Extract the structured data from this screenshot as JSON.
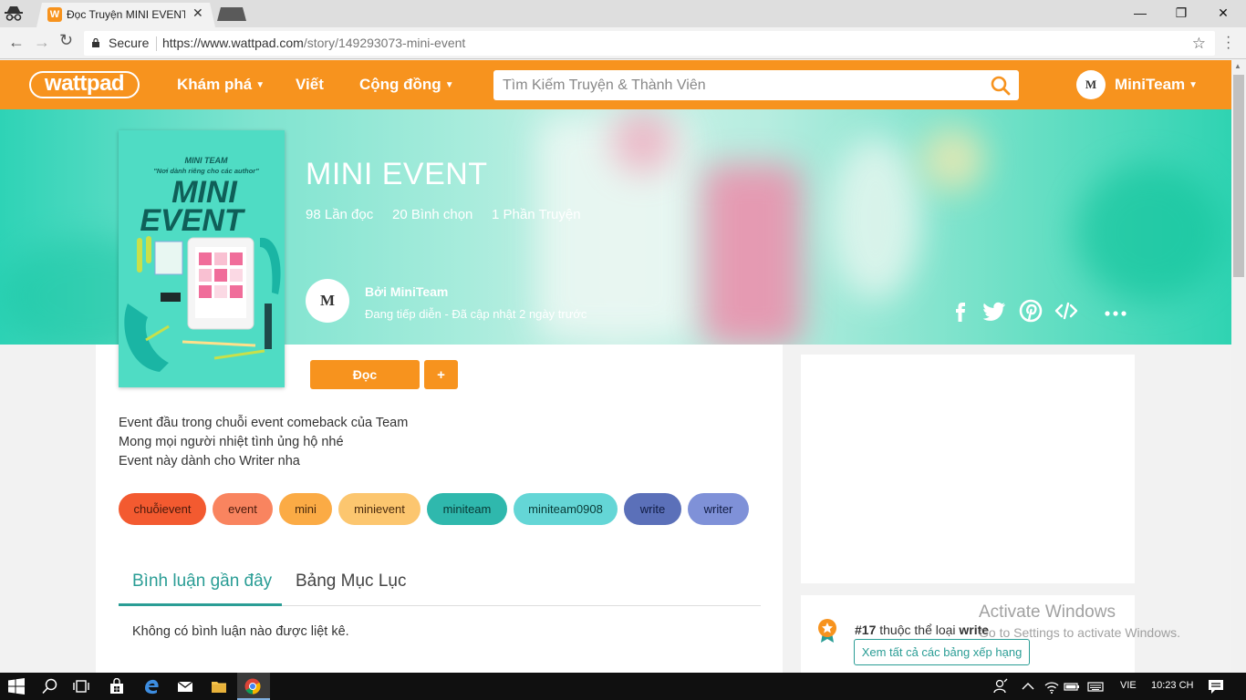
{
  "browser": {
    "tab_title": "Đọc Truyện MINI EVENT -",
    "tab_favicon": "W",
    "secure_label": "Secure",
    "url_host": "https://www.wattpad.com",
    "url_path": "/story/149293073-mini-event",
    "window_minimize": "—",
    "window_restore": "❐",
    "window_close": "✕"
  },
  "header": {
    "logo": "wattpad",
    "nav": [
      {
        "label": "Khám phá",
        "dropdown": true
      },
      {
        "label": "Viết",
        "dropdown": false
      },
      {
        "label": "Cộng đồng",
        "dropdown": true
      }
    ],
    "search_placeholder": "Tìm Kiếm Truyện & Thành Viên",
    "user_name": "MiniTeam",
    "user_initials": "M"
  },
  "story": {
    "title": "MINI EVENT",
    "stats": [
      "98 Lần đọc",
      "20 Bình chọn",
      "1 Phần Truyện"
    ],
    "author_prefix": "Bởi MiniTeam",
    "author_initials": "M",
    "status": "Đang tiếp diễn - Đã cập nhật 2 ngày trước",
    "cover": {
      "line1": "MINI TEAM",
      "line2": "\"Nơi dành riêng cho các author\"",
      "title_1": "MINI",
      "title_2": "EVENT"
    },
    "read_label": "Đọc",
    "add_label": "+",
    "description": [
      "Event đầu trong chuỗi event comeback của Team",
      "Mong mọi người nhiệt tình ủng hộ nhé",
      "Event này dành cho Writer nha"
    ],
    "tags": [
      {
        "label": "chuỗievent",
        "bg": "#f35a30",
        "fg": "#4a1a0c"
      },
      {
        "label": "event",
        "bg": "#f9845f",
        "fg": "#4a1a0c"
      },
      {
        "label": "mini",
        "bg": "#fbab45",
        "fg": "#4a2a0c"
      },
      {
        "label": "minievent",
        "bg": "#fcc66f",
        "fg": "#4a2a0c"
      },
      {
        "label": "miniteam",
        "bg": "#2fb8ad",
        "fg": "#083a36"
      },
      {
        "label": "miniteam0908",
        "bg": "#64d6d6",
        "fg": "#083a36"
      },
      {
        "label": "write",
        "bg": "#5b70b9",
        "fg": "#101c44"
      },
      {
        "label": "writer",
        "bg": "#7f91d8",
        "fg": "#101c44"
      }
    ]
  },
  "tabs": {
    "comments": "Bình luận gần đây",
    "toc": "Bảng Mục Lục",
    "no_comments": "Không có bình luận nào được liệt kê."
  },
  "ranking": {
    "rank": "#17",
    "middle": " thuộc thể loại ",
    "category": "write",
    "button": "Xem tất cả các bảng xếp hạng"
  },
  "watermark": {
    "line1": "Activate Windows",
    "line2": "Go to Settings to activate Windows."
  },
  "taskbar": {
    "language": "VIE",
    "time": "10:23 CH"
  },
  "colors": {
    "brand_orange": "#f7931e",
    "accent_teal": "#2a9d95"
  }
}
